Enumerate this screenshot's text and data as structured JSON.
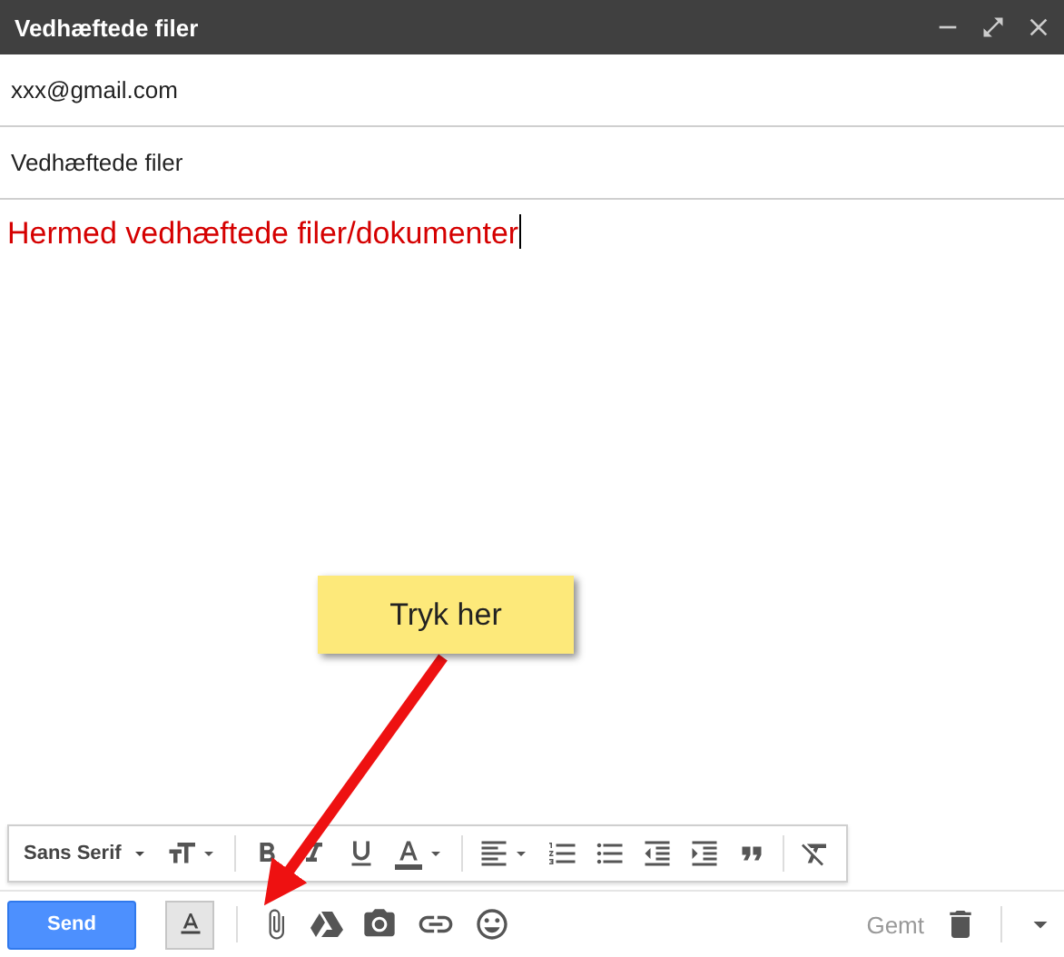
{
  "window": {
    "title": "Vedhæftede filer"
  },
  "to": {
    "value": "xxx@gmail.com"
  },
  "subject": {
    "value": "Vedhæftede filer"
  },
  "body": {
    "text": "Hermed vedhæftede filer/dokumenter"
  },
  "format_toolbar": {
    "font": "Sans Serif",
    "tools": [
      {
        "kind": "size",
        "dropdown": true
      },
      {
        "kind": "separator"
      },
      {
        "kind": "bold",
        "dropdown": false
      },
      {
        "kind": "italic",
        "dropdown": false
      },
      {
        "kind": "underline",
        "dropdown": false
      },
      {
        "kind": "color",
        "dropdown": true
      },
      {
        "kind": "separator"
      },
      {
        "kind": "align",
        "dropdown": true
      },
      {
        "kind": "numbered",
        "dropdown": false
      },
      {
        "kind": "bulleted",
        "dropdown": false
      },
      {
        "kind": "outdent",
        "dropdown": false
      },
      {
        "kind": "indent",
        "dropdown": false
      },
      {
        "kind": "quote",
        "dropdown": false
      },
      {
        "kind": "separator"
      },
      {
        "kind": "clear",
        "dropdown": false
      }
    ]
  },
  "bottom_bar": {
    "send": "Send",
    "formatting_toggle": {
      "selected": true
    },
    "status": "Gemt"
  },
  "callout": {
    "text": "Tryk her"
  }
}
